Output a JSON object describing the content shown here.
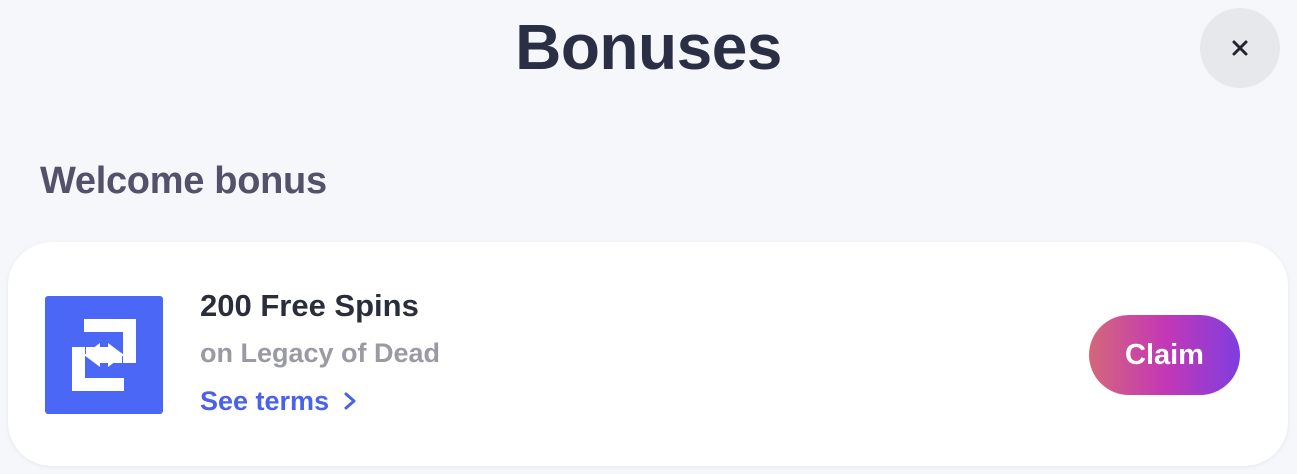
{
  "header": {
    "title": "Bonuses",
    "close_icon": "close-icon"
  },
  "section": {
    "title": "Welcome bonus"
  },
  "bonus": {
    "icon": "refresh-arrows-icon",
    "name": "200 Free Spins",
    "subtitle": "on Legacy of Dead",
    "terms_label": "See terms",
    "terms_icon": "chevron-right-icon",
    "claim_label": "Claim"
  },
  "colors": {
    "background": "#f6f7fb",
    "title": "#2a2f45",
    "icon_tile": "#4a68f5",
    "link": "#4a62ea",
    "claim_gradient": [
      "#d4677a",
      "#c438b5",
      "#7f3de0"
    ]
  }
}
